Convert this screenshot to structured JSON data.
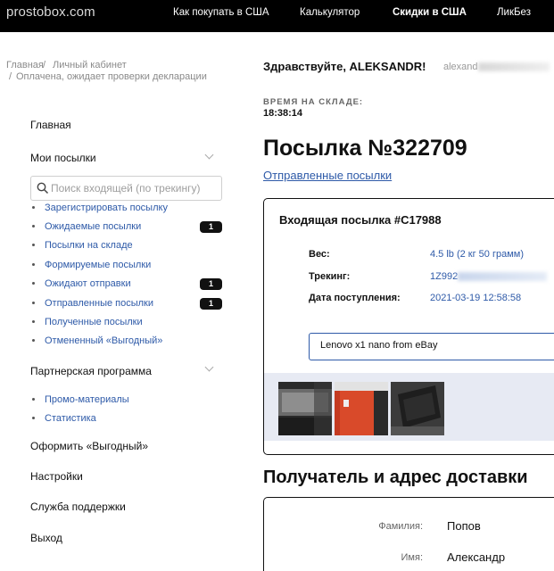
{
  "header": {
    "logo": "prostobox.com",
    "nav": [
      {
        "label": "Как покупать в США"
      },
      {
        "label": "Калькулятор"
      },
      {
        "label": "Скидки в США"
      },
      {
        "label": "ЛикБез"
      }
    ]
  },
  "breadcrumb": {
    "items": [
      "Главная",
      "Личный кабинет",
      "Оплачена, ожидает проверки декларации"
    ],
    "separator": "/"
  },
  "sidebar": {
    "home": "Главная",
    "my_parcels": "Мои посылки",
    "search_placeholder": "Поиск входящей (по трекингу)",
    "parcel_items": [
      {
        "label": "Зарегистрировать посылку",
        "badge": ""
      },
      {
        "label": "Ожидаемые посылки",
        "badge": "1"
      },
      {
        "label": "Посылки на складе",
        "badge": ""
      },
      {
        "label": "Формируемые посылки",
        "badge": ""
      },
      {
        "label": "Ожидают отправки",
        "badge": "1"
      },
      {
        "label": "Отправленные посылки",
        "badge": "1"
      },
      {
        "label": "Полученные посылки",
        "badge": ""
      },
      {
        "label": "Отмененный «Выгодный»",
        "badge": ""
      }
    ],
    "partner": "Партнерская программа",
    "partner_items": [
      {
        "label": "Промо-материалы"
      },
      {
        "label": "Статистика"
      }
    ],
    "order_profitable": "Оформить «Выгодный»",
    "settings": "Настройки",
    "support": "Служба поддержки",
    "logout": "Выход"
  },
  "main": {
    "greeting": "Здравствуйте, ALEKSANDR!",
    "email_prefix": "alexand",
    "warehouse_label": "ВРЕМЯ НА СКЛАДЕ:",
    "warehouse_time": "18:38:14",
    "title": "Посылка №322709",
    "sent_link": "Отправленные посылки",
    "incoming": {
      "title": "Входящая посылка #C17988",
      "weight_label": "Вес:",
      "weight_value": "4.5 lb (2 кг 50 грамм)",
      "tracking_label": "Трекинг:",
      "tracking_value": "1Z992",
      "arrival_label": "Дата поступления:",
      "arrival_value": "2021-03-19 12:58:58",
      "description": "Lenovo x1 nano from eBay"
    },
    "recipient_title": "Получатель и адрес доставки",
    "recipient": {
      "surname_label": "Фамилия:",
      "surname_value": "Попов",
      "name_label": "Имя:",
      "name_value": "Александр"
    }
  },
  "colors": {
    "topbar": "#000000",
    "link": "#2e5aa8",
    "badge": "#111111",
    "gallery_bg": "#e7eaf3"
  }
}
